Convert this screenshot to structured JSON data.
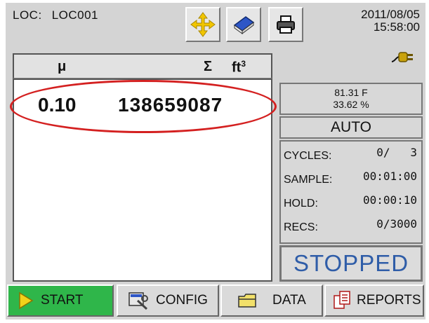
{
  "header": {
    "loc_label": "LOC:",
    "loc_value": "LOC001",
    "date": "2011/08/05",
    "time": "15:58:00"
  },
  "toolbar": {
    "move_icon": "move-arrows-icon",
    "book_icon": "book-icon",
    "print_icon": "printer-icon"
  },
  "power": {
    "icon": "ac-power-plug-icon"
  },
  "table": {
    "col_mu": "μ",
    "col_sigma": "Σ",
    "col_unit": "ft",
    "col_unit_sup": "3",
    "row": {
      "mu": "0.10",
      "total": "138659087"
    }
  },
  "environment": {
    "temperature": "81.31 F",
    "humidity": "33.62 %"
  },
  "mode": "AUTO",
  "stats": [
    {
      "label": "CYCLES:",
      "value": "0/   3"
    },
    {
      "label": "SAMPLE:",
      "value": "00:01:00"
    },
    {
      "label": "HOLD:",
      "value": "00:00:10"
    },
    {
      "label": "RECS:",
      "value": "0/3000"
    }
  ],
  "status": "STOPPED",
  "buttons": {
    "start": "START",
    "config": "CONFIG",
    "data": "DATA",
    "reports": "REPORTS"
  },
  "colors": {
    "start_green": "#2fb64a",
    "status_blue": "#2f5da8",
    "highlight_red": "#d42020"
  }
}
